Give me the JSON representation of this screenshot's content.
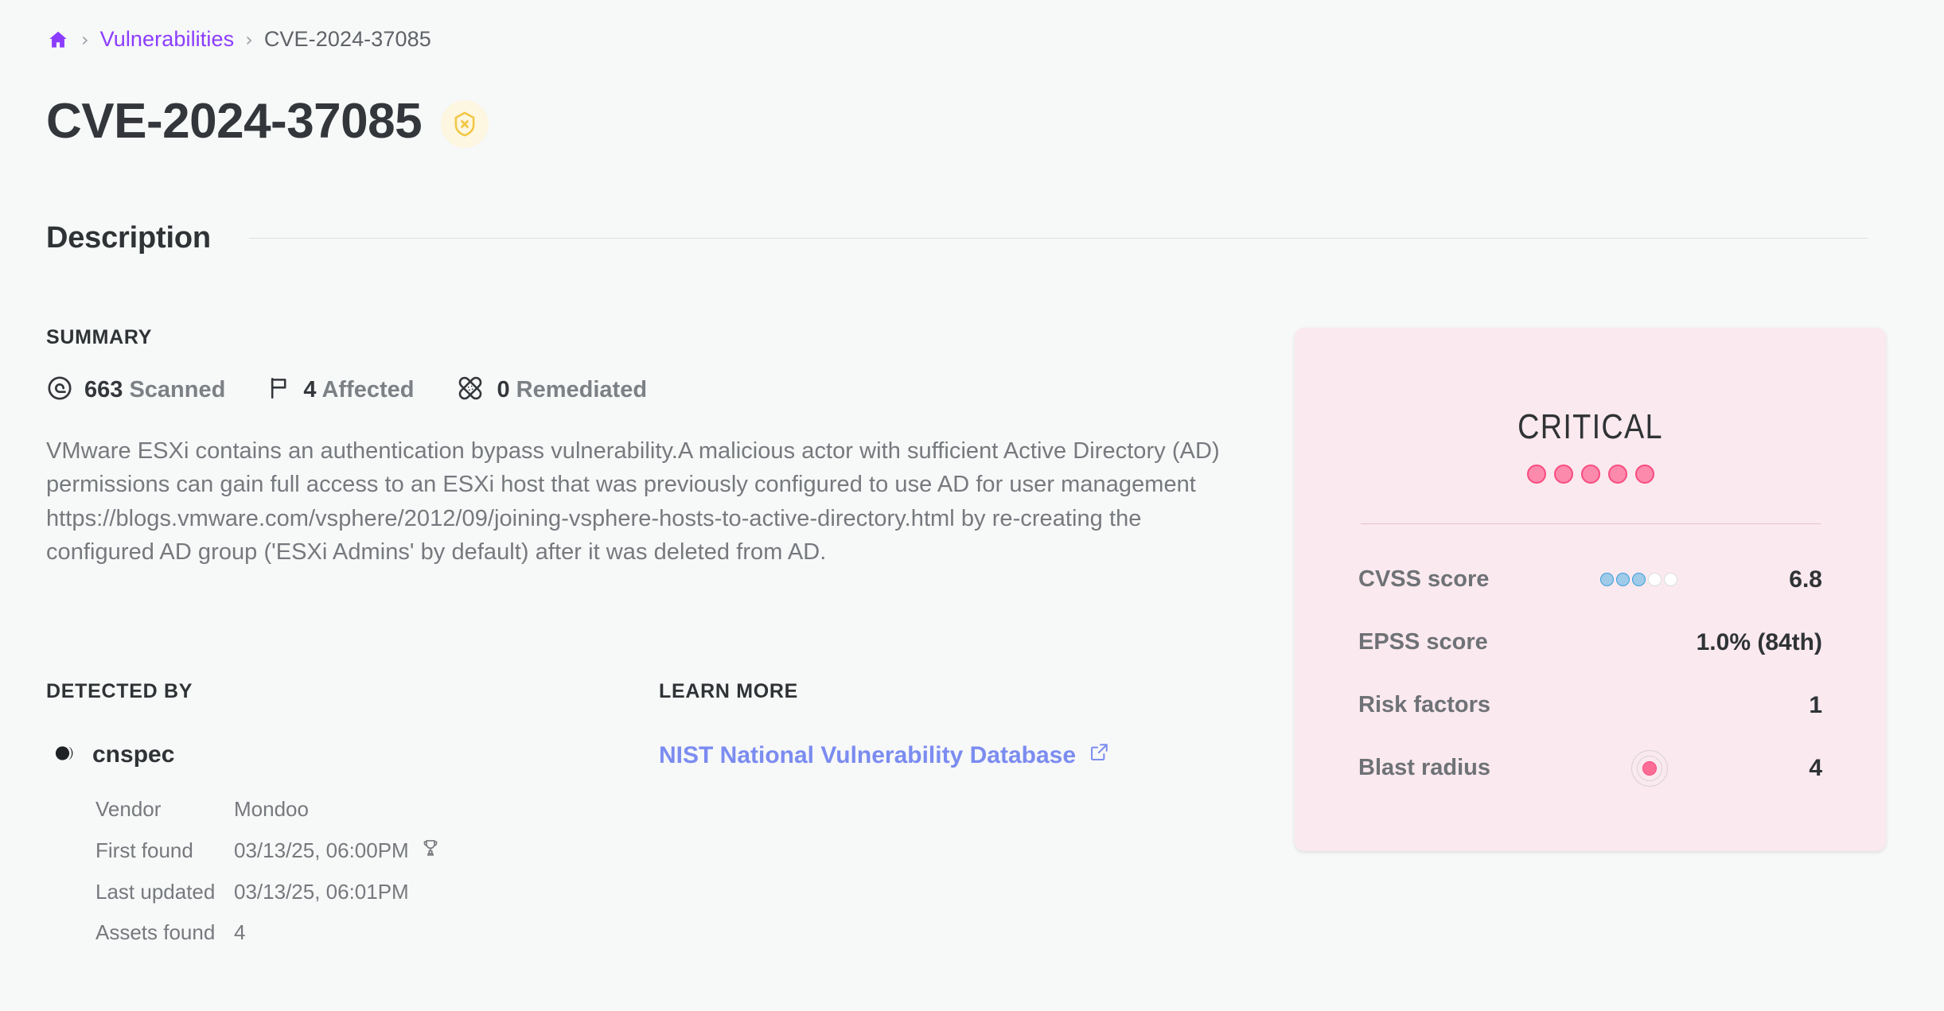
{
  "breadcrumb": {
    "home_icon": "home-icon",
    "separator": "›",
    "link_label": "Vulnerabilities",
    "current_label": "CVE-2024-37085"
  },
  "header": {
    "title": "CVE-2024-37085",
    "severity_icon": "shield-x-icon",
    "severity_icon_color": "#f2c744",
    "severity_icon_bg": "#fdf6e0"
  },
  "section": {
    "description_heading": "Description"
  },
  "summary": {
    "kicker": "SUMMARY",
    "stats": [
      {
        "icon": "target-scan-icon",
        "count": "663",
        "label": "Scanned"
      },
      {
        "icon": "flag-icon",
        "count": "4",
        "label": "Affected"
      },
      {
        "icon": "bandage-icon",
        "count": "0",
        "label": "Remediated"
      }
    ],
    "description": "VMware ESXi contains an authentication bypass vulnerability.A malicious actor with sufficient Active Directory (AD) permissions can gain full access to an ESXi host that was previously configured to use AD for user management https://blogs.vmware.com/vsphere/2012/09/joining-vsphere-hosts-to-active-directory.html by re-creating the configured AD group ('ESXi Admins' by default) after it was deleted from AD."
  },
  "detected_by": {
    "kicker": "DETECTED BY",
    "tool_icon": "cnspec-logo-icon",
    "tool_name": "cnspec",
    "rows": [
      {
        "key": "Vendor",
        "value": "Mondoo",
        "icon": ""
      },
      {
        "key": "First found",
        "value": "03/13/25, 06:00PM",
        "icon": "trophy-icon"
      },
      {
        "key": "Last updated",
        "value": "03/13/25, 06:01PM",
        "icon": ""
      },
      {
        "key": "Assets found",
        "value": "4",
        "icon": ""
      }
    ]
  },
  "learn_more": {
    "kicker": "LEARN MORE",
    "link_label": "NIST National Vulnerability Database",
    "link_icon": "external-link-icon",
    "link_color": "#7b8cf0"
  },
  "severity_card": {
    "bg_color": "#fae9ee",
    "level": "CRITICAL",
    "level_dots_total": 5,
    "level_dots_filled": 5,
    "dot_color": "#fb8aac",
    "rows": [
      {
        "label": "CVSS score",
        "value": "6.8",
        "meter": {
          "type": "dots",
          "total": 5,
          "filled": 3,
          "color": "#9fcbe8"
        }
      },
      {
        "label": "EPSS score",
        "value": "1.0% (84th)",
        "meter": {
          "type": "none"
        }
      },
      {
        "label": "Risk factors",
        "value": "1",
        "meter": {
          "type": "none"
        }
      },
      {
        "label": "Blast radius",
        "value": "4",
        "meter": {
          "type": "blast",
          "icon": "blast-radius-icon",
          "color": "#fb6d95"
        }
      }
    ]
  }
}
